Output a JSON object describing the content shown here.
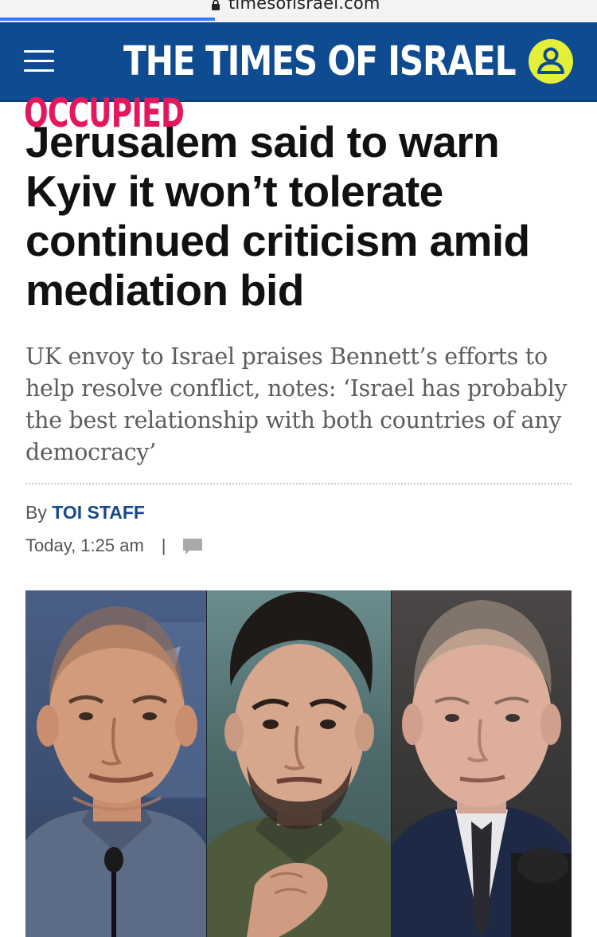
{
  "browser": {
    "url": "timesofisrael.com",
    "load_progress": 0.36
  },
  "header": {
    "logo_text": "THE TIMES OF ISRAEL",
    "brand_color": "#0e4b91",
    "user_button_color": "#e4ef3a",
    "icons": [
      "menu-icon",
      "user-icon"
    ]
  },
  "article": {
    "stamp": "OCCUPIED",
    "stamp_color": "#e4175a",
    "headline": "Jerusalem said to warn Kyiv it won’t tolerate continued criticism amid mediation bid",
    "subheadline": "UK envoy to Israel praises Bennett’s efforts to help resolve conflict, notes: ‘Israel has probably the best relationship with both countries of any democracy’",
    "byline_prefix": "By",
    "author": "TOI STAFF",
    "timestamp": "Today, 1:25 am",
    "separator": "|"
  }
}
